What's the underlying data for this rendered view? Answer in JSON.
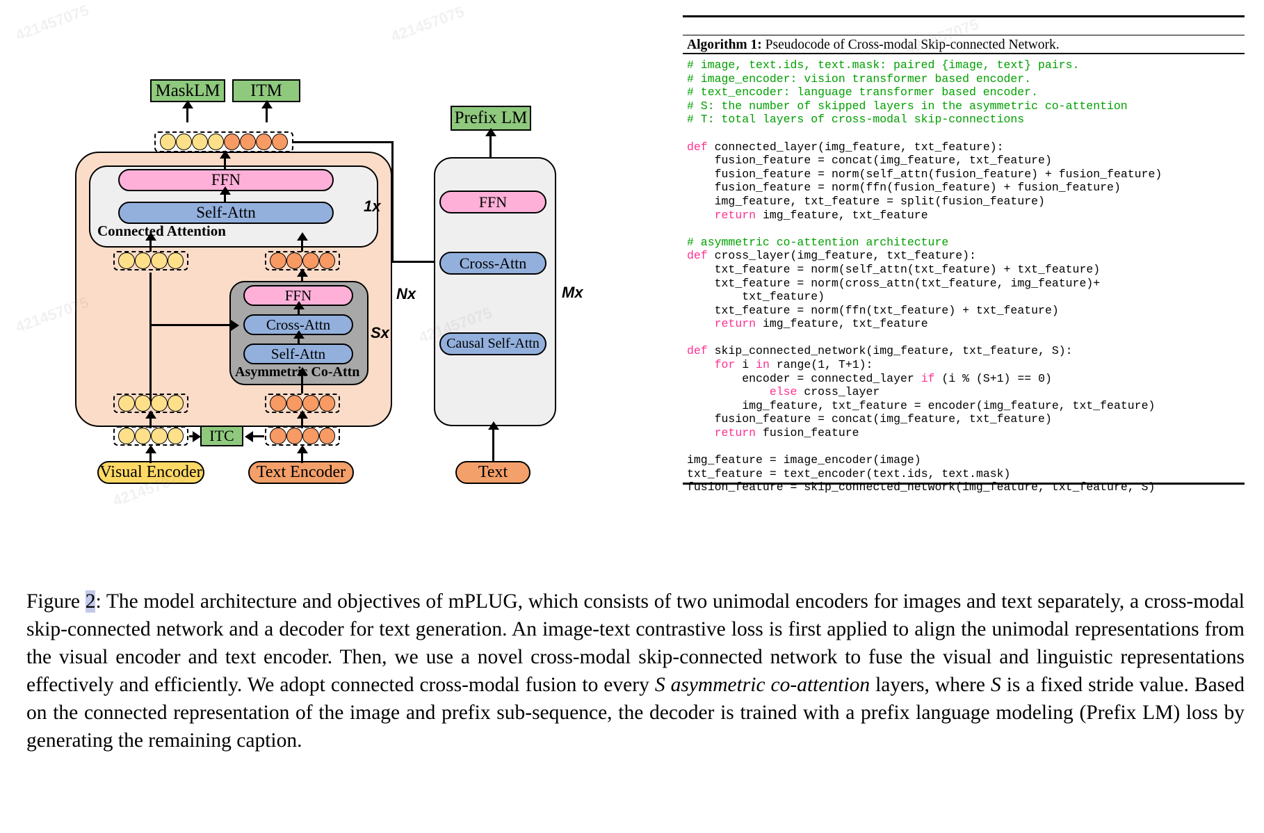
{
  "figure": {
    "objective_heads": [
      {
        "id": "masklm",
        "label": "MaskLM"
      },
      {
        "id": "itm",
        "label": "ITM"
      },
      {
        "id": "prefixlm",
        "label": "Prefix LM"
      }
    ],
    "connected_attention": {
      "title": "Connected Attention",
      "multiplier": "1x",
      "layers": [
        {
          "label": "FFN",
          "color": "pink"
        },
        {
          "label": "Self-Attn",
          "color": "blue"
        }
      ]
    },
    "asymmetric_coattn": {
      "title": "Asymmetric Co-Attn",
      "multiplier": "Sx",
      "layers": [
        {
          "label": "FFN",
          "color": "pink"
        },
        {
          "label": "Cross-Attn",
          "color": "blue"
        },
        {
          "label": "Self-Attn",
          "color": "blue"
        }
      ]
    },
    "skip_network_multiplier": "Nx",
    "decoder": {
      "multiplier": "Mx",
      "layers": [
        {
          "label": "FFN",
          "color": "pink"
        },
        {
          "label": "Cross-Attn",
          "color": "blue"
        },
        {
          "label": "Causal Self-Attn",
          "color": "blue"
        }
      ]
    },
    "encoders": [
      {
        "id": "visual-encoder",
        "label": "Visual Encoder",
        "color": "yellow"
      },
      {
        "id": "text-encoder",
        "label": "Text Encoder",
        "color": "orange"
      },
      {
        "id": "text-input",
        "label": "Text",
        "color": "orange"
      }
    ],
    "itc": {
      "label": "ITC"
    },
    "token_groups": {
      "fused_output": {
        "yellow": 4,
        "orange": 4
      },
      "visual_mid": {
        "yellow": 4,
        "orange": 0
      },
      "text_mid": {
        "yellow": 0,
        "orange": 4
      },
      "visual_in": {
        "yellow": 4,
        "orange": 0
      },
      "text_in": {
        "yellow": 0,
        "orange": 4
      },
      "visual_enc_out": {
        "yellow": 4,
        "orange": 0
      },
      "text_enc_out": {
        "yellow": 0,
        "orange": 4
      }
    },
    "colors": {
      "green": "#8fc97e",
      "pink": "#ffb0d8",
      "blue": "#93b0dd",
      "yellow": "#ffd966",
      "orange": "#f4a06a",
      "peach": "#fbdcc8",
      "gray_card": "#efefef",
      "dark_gray": "#a8a8a8",
      "token_yellow": "#ffe08a",
      "token_orange": "#f79a63"
    }
  },
  "algorithm": {
    "caption_prefix": "Algorithm 1:",
    "caption_rest": " Pseudocode of Cross-modal Skip-connected Network.",
    "code_lines": [
      {
        "text": "# image, text.ids, text.mask: paired {image, text} pairs.",
        "kind": "comment"
      },
      {
        "text": "# image_encoder: vision transformer based encoder.",
        "kind": "comment"
      },
      {
        "text": "# text_encoder: language transformer based encoder.",
        "kind": "comment"
      },
      {
        "text": "# S: the number of skipped layers in the asymmetric co-attention",
        "kind": "comment"
      },
      {
        "text": "# T: total layers of cross-modal skip-connections",
        "kind": "comment"
      },
      {
        "text": "",
        "kind": "blank"
      },
      {
        "text": "def connected_layer(img_feature, txt_feature):",
        "kind": "code",
        "kw": "def"
      },
      {
        "text": "    fusion_feature = concat(img_feature, txt_feature)",
        "kind": "code"
      },
      {
        "text": "    fusion_feature = norm(self_attn(fusion_feature) + fusion_feature)",
        "kind": "code"
      },
      {
        "text": "    fusion_feature = norm(ffn(fusion_feature) + fusion_feature)",
        "kind": "code"
      },
      {
        "text": "    img_feature, txt_feature = split(fusion_feature)",
        "kind": "code"
      },
      {
        "text": "    return img_feature, txt_feature",
        "kind": "code",
        "kw": "return"
      },
      {
        "text": "",
        "kind": "blank"
      },
      {
        "text": "# asymmetric co-attention architecture",
        "kind": "comment"
      },
      {
        "text": "def cross_layer(img_feature, txt_feature):",
        "kind": "code",
        "kw": "def"
      },
      {
        "text": "    txt_feature = norm(self_attn(txt_feature) + txt_feature)",
        "kind": "code"
      },
      {
        "text": "    txt_feature = norm(cross_attn(txt_feature, img_feature)+",
        "kind": "code"
      },
      {
        "text": "        txt_feature)",
        "kind": "code"
      },
      {
        "text": "    txt_feature = norm(ffn(txt_feature) + txt_feature)",
        "kind": "code"
      },
      {
        "text": "    return img_feature, txt_feature",
        "kind": "code",
        "kw": "return"
      },
      {
        "text": "",
        "kind": "blank"
      },
      {
        "text": "def skip_connected_network(img_feature, txt_feature, S):",
        "kind": "code",
        "kw": "def"
      },
      {
        "text": "    for i in range(1, T+1):",
        "kind": "code",
        "kw": "for-in"
      },
      {
        "text": "        encoder = connected_layer if (i % (S+1) == 0)",
        "kind": "code",
        "kw": "if"
      },
      {
        "text": "            else cross_layer",
        "kind": "code",
        "kw": "else"
      },
      {
        "text": "        img_feature, txt_feature = encoder(img_feature, txt_feature)",
        "kind": "code"
      },
      {
        "text": "    fusion_feature = concat(img_feature, txt_feature)",
        "kind": "code"
      },
      {
        "text": "    return fusion_feature",
        "kind": "code",
        "kw": "return"
      },
      {
        "text": "",
        "kind": "blank"
      },
      {
        "text": "img_feature = image_encoder(image)",
        "kind": "code"
      },
      {
        "text": "txt_feature = text_encoder(text.ids, text.mask)",
        "kind": "code"
      },
      {
        "text": "fusion_feature = skip_connected_network(img_feature, txt_feature, S)",
        "kind": "code"
      }
    ],
    "colors": {
      "comment": "#00a000",
      "keyword": "#ff2f92",
      "plain": "#000000"
    }
  },
  "caption": {
    "figure_label": "Figure ",
    "figure_number": "2",
    "text": ": The model architecture and objectives of mPLUG, which consists of two unimodal encoders for images and text separately, a cross-modal skip-connected network and a decoder for text generation. An image-text contrastive loss is first applied to align the unimodal representations from the visual encoder and text encoder. Then, we use a novel cross-modal skip-connected network to fuse the visual and linguistic representations effectively and efficiently. We adopt connected cross-modal fusion to every ",
    "italic_1": "S asymmetric co-attention",
    "text_2": " layers, where ",
    "italic_2": "S",
    "text_3": " is a fixed stride value. Based on the connected representation of the image and prefix sub-sequence, the decoder is trained with a prefix language modeling (Prefix LM) loss by generating the remaining caption."
  }
}
